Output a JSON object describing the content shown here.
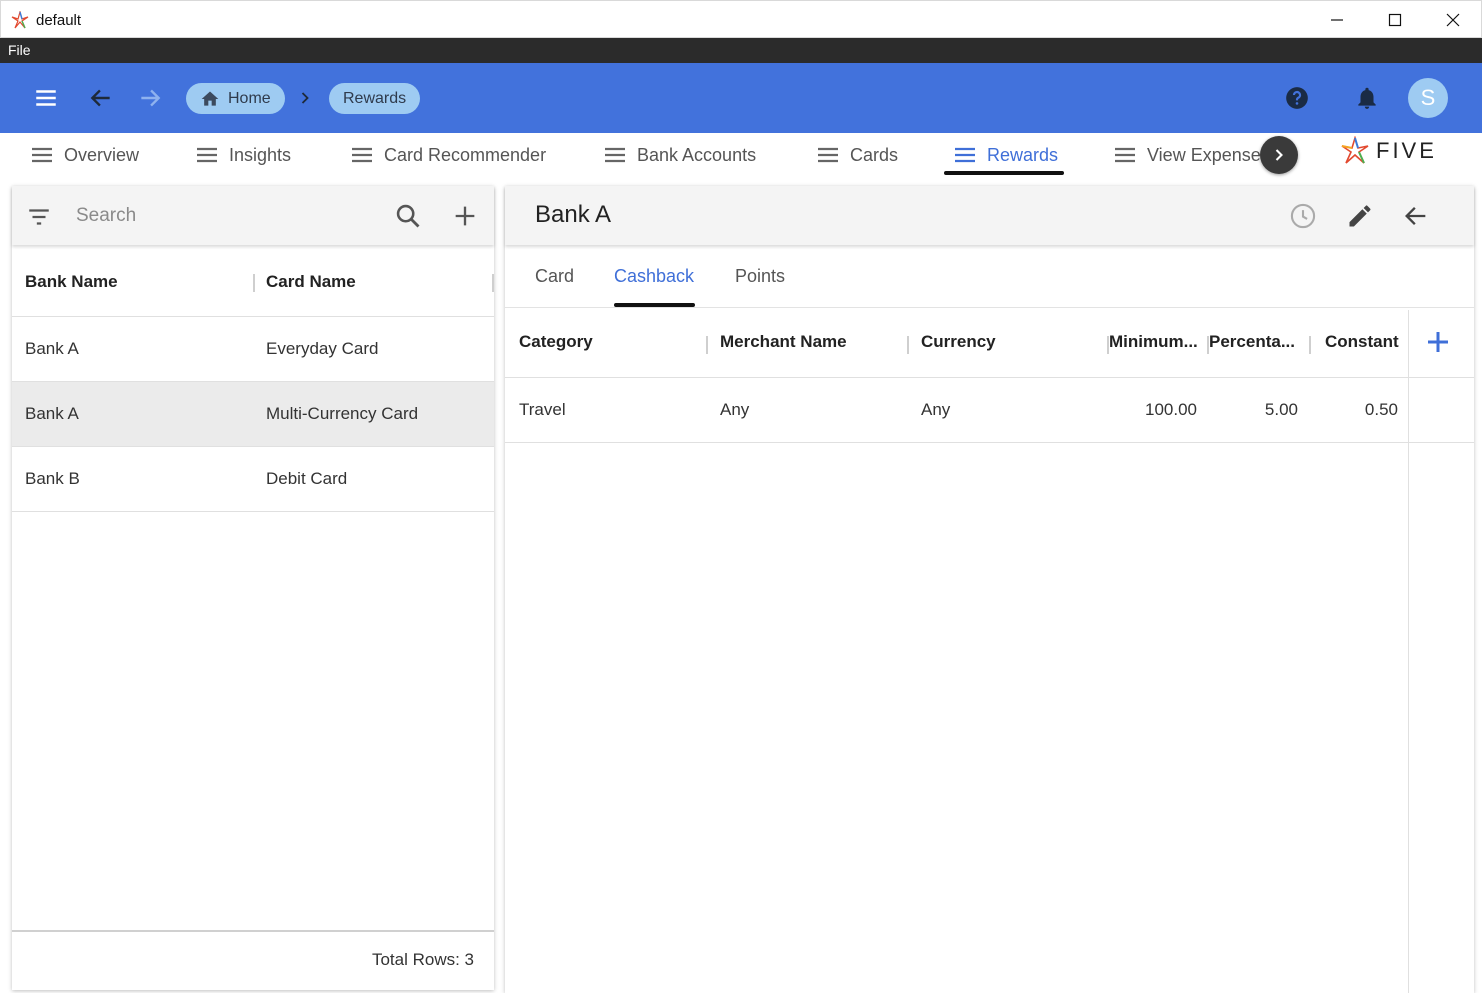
{
  "window": {
    "title": "default",
    "controls": [
      "minimize",
      "maximize",
      "close"
    ]
  },
  "menubar": {
    "file": "File"
  },
  "appbar": {
    "breadcrumbs": [
      {
        "label": "Home",
        "icon": "home-icon"
      },
      {
        "label": "Rewards"
      }
    ],
    "avatar_initial": "S",
    "color": "#4272dc"
  },
  "nav": {
    "tabs": [
      {
        "label": "Overview"
      },
      {
        "label": "Insights"
      },
      {
        "label": "Card Recommender"
      },
      {
        "label": "Bank Accounts"
      },
      {
        "label": "Cards"
      },
      {
        "label": "Rewards",
        "active": true
      },
      {
        "label": "View Expenses"
      }
    ],
    "logo": "FIVE",
    "accent": "#3f6fd8"
  },
  "list": {
    "search_placeholder": "Search",
    "columns": [
      "Bank Name",
      "Card Name"
    ],
    "rows": [
      {
        "bank": "Bank A",
        "card": "Everyday Card"
      },
      {
        "bank": "Bank A",
        "card": "Multi-Currency Card",
        "selected": true
      },
      {
        "bank": "Bank B",
        "card": "Debit Card"
      }
    ],
    "total_rows": "Total Rows: 3"
  },
  "detail": {
    "title": "Bank A",
    "tabs": [
      "Card",
      "Cashback",
      "Points"
    ],
    "active_tab": "Cashback",
    "columns": [
      "Category",
      "Merchant Name",
      "Currency",
      "Minimum...",
      "Percenta...",
      "Constant"
    ],
    "rows": [
      {
        "category": "Travel",
        "merchant": "Any",
        "currency": "Any",
        "minimum": "100.00",
        "percentage": "5.00",
        "constant": "0.50"
      }
    ]
  }
}
